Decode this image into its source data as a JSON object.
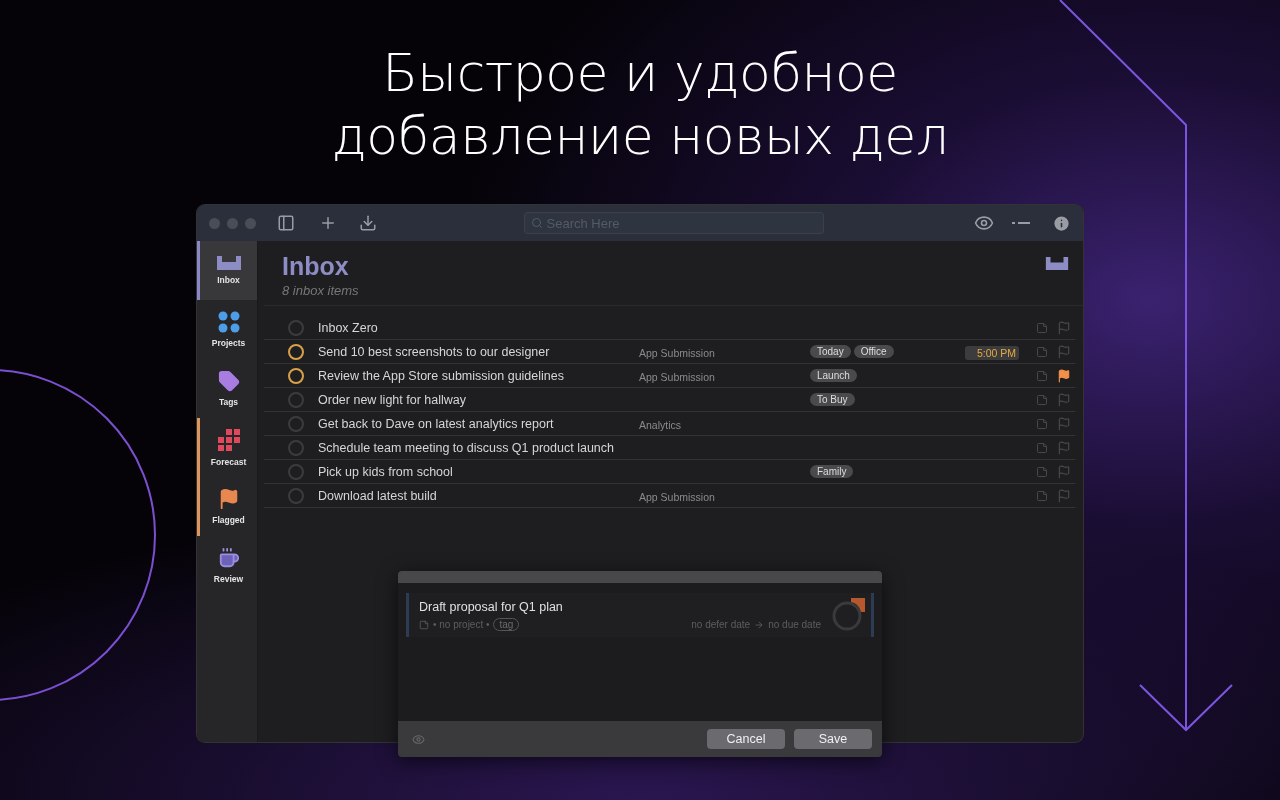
{
  "headline": [
    "Быстрое и удобное",
    "добавление новых дел"
  ],
  "toolbar": {
    "search": {
      "placeholder": "Search Here"
    }
  },
  "sidebar": [
    {
      "kind": "inbox",
      "label": "Inbox",
      "selected": true,
      "highlighted": false
    },
    {
      "kind": "projects",
      "label": "Projects",
      "selected": false,
      "highlighted": false
    },
    {
      "kind": "tags",
      "label": "Tags",
      "selected": false,
      "highlighted": false
    },
    {
      "kind": "forecast",
      "label": "Forecast",
      "selected": false,
      "highlighted": true
    },
    {
      "kind": "flagged",
      "label": "Flagged",
      "selected": false,
      "highlighted": true
    },
    {
      "kind": "review",
      "label": "Review",
      "selected": false,
      "highlighted": false
    }
  ],
  "header": {
    "title": "Inbox",
    "subtitle": "8 inbox items"
  },
  "tasks": [
    {
      "title": "Inbox Zero",
      "color": "#3c3c3f",
      "flagged": false
    },
    {
      "title": "Send 10 best screenshots to our designer",
      "project": "App Submission",
      "tags": [
        "Today",
        "Office"
      ],
      "due": "5:00 PM",
      "color": "#d9a14a",
      "flagged": false
    },
    {
      "title": "Review the App Store submission guidelines",
      "project": "App Submission",
      "tags": [
        "Launch"
      ],
      "color": "#d9a14a",
      "flagged": true
    },
    {
      "title": "Order new light for hallway",
      "tags": [
        "To Buy"
      ],
      "color": "#3c3c3f",
      "flagged": false
    },
    {
      "title": "Get back to Dave on latest analytics report",
      "project": "Analytics",
      "color": "#3c3c3f",
      "flagged": false
    },
    {
      "title": "Schedule team meeting to discuss Q1 product launch",
      "color": "#3c3c3f",
      "flagged": false
    },
    {
      "title": "Pick up kids from school",
      "tags": [
        "Family"
      ],
      "color": "#3c3c3f",
      "flagged": false
    },
    {
      "title": "Download latest build",
      "project": "App Submission",
      "color": "#3c3c3f",
      "flagged": false
    }
  ],
  "quick_entry": {
    "value": "Draft proposal for Q1 plan",
    "project": "• no project •",
    "tag": "tag",
    "defer": "no defer date",
    "due": "no due date",
    "buttons": [
      "Cancel",
      "Save"
    ]
  }
}
